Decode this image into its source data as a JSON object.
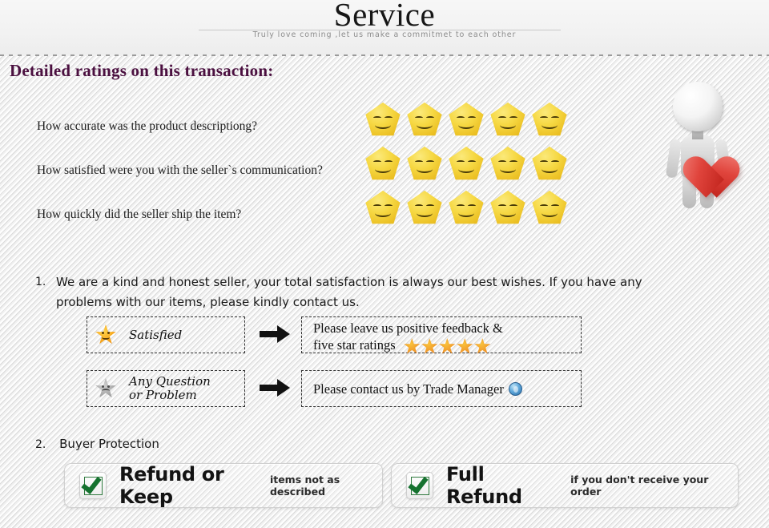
{
  "header": {
    "title": "Service",
    "subtitle": "Truly love coming ,let us make a commitmet to each other"
  },
  "section": {
    "title": "Detailed ratings on this transaction:"
  },
  "ratings": {
    "questions": [
      {
        "text": "How accurate was the product descriptiong?",
        "stars": 5
      },
      {
        "text": "How satisfied were you with the seller`s communication?",
        "stars": 5
      },
      {
        "text": "How quickly did the seller ship the item?",
        "stars": 5
      }
    ]
  },
  "mascot": {
    "description": "3d-figure-holding-heart",
    "heart_color": "#d9342b"
  },
  "notes": {
    "item1": {
      "number": "1.",
      "text": "We are a kind and honest seller, your total satisfaction is always our best wishes. If you have any problems with our items, please kindly contact us."
    },
    "item2": {
      "number": "2.",
      "text": "Buyer Protection"
    }
  },
  "flow": {
    "row1": {
      "left_label": "Satisfied",
      "left_icon": "happy-star-icon",
      "right_line1": "Please leave us positive feedback &",
      "right_line2": "five star ratings",
      "right_star_count": 5
    },
    "row2": {
      "left_label_line1": "Any Question",
      "left_label_line2": "or Problem",
      "left_icon": "sad-star-icon",
      "right_text": "Please contact us by Trade Manager",
      "right_icon": "trade-manager-icon"
    }
  },
  "protection": {
    "left": {
      "main": "Refund or Keep",
      "sub": "items not as described",
      "icon": "green-check-icon"
    },
    "right": {
      "main": "Full Refund",
      "sub": "if you don't receive your order",
      "icon": "green-check-icon"
    }
  },
  "colors": {
    "heading": "#4b1040",
    "star": "#f0c01e",
    "check": "#15722f",
    "heart": "#d9342b"
  }
}
